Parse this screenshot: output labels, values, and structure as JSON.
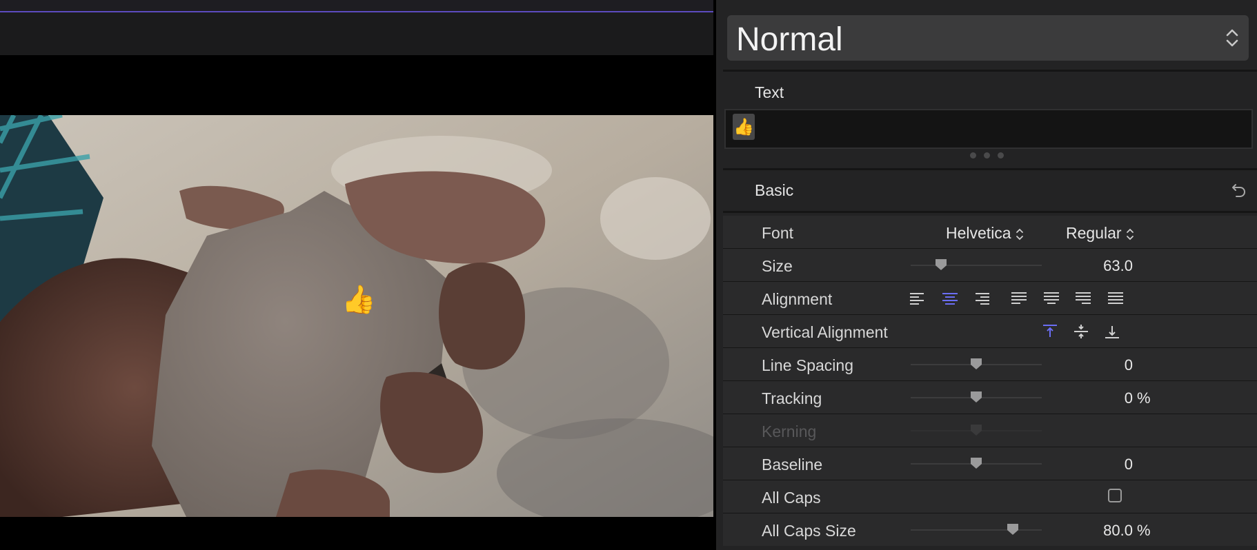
{
  "inspector": {
    "style_preset": "Normal",
    "text_section_label": "Text",
    "text_content": "👍",
    "basic_section_label": "Basic",
    "rows": {
      "font": {
        "label": "Font",
        "family": "Helvetica",
        "typeface": "Regular"
      },
      "size": {
        "label": "Size",
        "value": "63.0",
        "slider_fraction": 0.23
      },
      "alignment": {
        "label": "Alignment",
        "options": [
          "left",
          "center",
          "right",
          "justify-left",
          "justify-center",
          "justify-right",
          "justify-full"
        ],
        "selected": "center"
      },
      "vertical_alignment": {
        "label": "Vertical Alignment",
        "options": [
          "top",
          "middle",
          "bottom"
        ],
        "selected": "top"
      },
      "line_spacing": {
        "label": "Line Spacing",
        "value": "0",
        "slider_fraction": 0.5
      },
      "tracking": {
        "label": "Tracking",
        "value": "0",
        "unit": "%",
        "slider_fraction": 0.5
      },
      "kerning": {
        "label": "Kerning",
        "enabled": false,
        "slider_fraction": 0.5
      },
      "baseline": {
        "label": "Baseline",
        "value": "0",
        "slider_fraction": 0.5
      },
      "all_caps": {
        "label": "All Caps",
        "checked": false
      },
      "all_caps_size": {
        "label": "All Caps Size",
        "value": "80.0",
        "unit": "%",
        "slider_fraction": 0.78
      }
    }
  },
  "viewer": {
    "overlay_text": "👍"
  },
  "colors": {
    "accent": "#5d4bbf",
    "selected_alignment": "#6b6ef5",
    "panel_bg": "#232324",
    "row_bg": "#2a2a2b"
  },
  "icons": [
    "chevron-updown-icon",
    "reset-arrow-icon",
    "text-align-icons",
    "vertical-align-icons",
    "slider-knob-icon",
    "checkbox-icon"
  ]
}
